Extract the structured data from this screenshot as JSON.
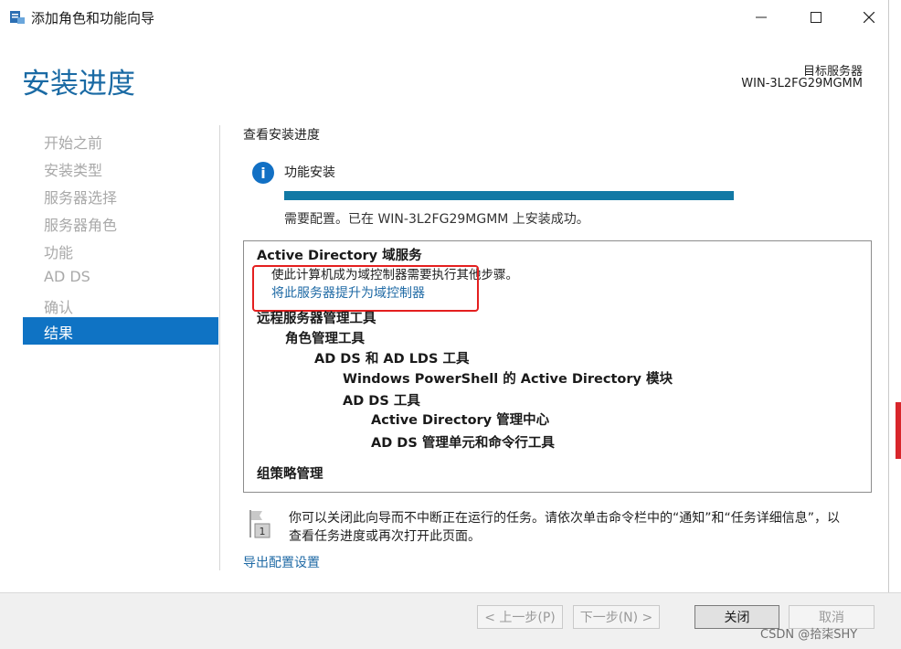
{
  "window": {
    "title": "添加角色和功能向导"
  },
  "header": {
    "title": "安装进度",
    "target_label": "目标服务器",
    "target_name": "WIN-3L2FG29MGMM"
  },
  "sidebar": {
    "steps": [
      "开始之前",
      "安装类型",
      "服务器选择",
      "服务器角色",
      "功能",
      "AD DS",
      "确认"
    ],
    "active_step": "结果"
  },
  "content": {
    "section_title": "查看安装进度",
    "feature_install_label": "功能安装",
    "progress_percent": 100,
    "status_text": "需要配置。已在 WIN-3L2FG29MGMM 上安装成功。",
    "results": {
      "ad_ds_title": "Active Directory 域服务",
      "ad_ds_desc": "使此计算机成为域控制器需要执行其他步骤。",
      "promote_link": "将此服务器提升为域控制器",
      "rsat": "远程服务器管理工具",
      "role_tools": "角色管理工具",
      "adds_adlds_tools": "AD DS 和 AD LDS 工具",
      "ps_module": "Windows PowerShell 的 Active Directory 模块",
      "adds_tools": "AD DS 工具",
      "ad_admin_center": "Active Directory 管理中心",
      "adds_snapins": "AD DS 管理单元和命令行工具",
      "gpm": "组策略管理"
    },
    "notice_line1": "你可以关闭此向导而不中断正在运行的任务。请依次单击命令栏中的“通知”和“任务详细信息”，以",
    "notice_line2": "查看任务进度或再次打开此页面。",
    "notice_badge": "1",
    "export_link": "导出配置设置"
  },
  "footer": {
    "prev": "< 上一步(P)",
    "next": "下一步(N) >",
    "close": "关闭",
    "cancel": "取消"
  },
  "watermark": "CSDN @拾柒SHY",
  "colors": {
    "accent": "#1a6aa4",
    "active_step": "#0f73c4",
    "progress": "#1279a5",
    "highlight": "#e41f1f",
    "link": "#1f6aa5"
  },
  "icons": {
    "app": "server-manager-icon",
    "info": "info-icon",
    "notice": "flag-icon"
  }
}
